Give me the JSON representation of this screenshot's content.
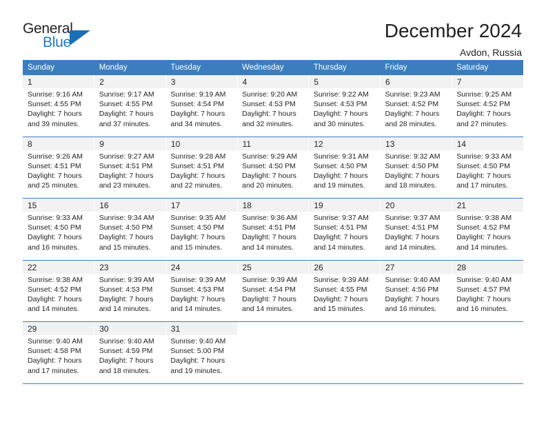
{
  "logo": {
    "word_top": "General",
    "word_bottom": "Blue",
    "triangle_icon": "triangle-icon",
    "accent_color": "#2079c4"
  },
  "header": {
    "title": "December 2024",
    "subtitle": "Avdon, Russia"
  },
  "theme": {
    "header_blue": "#3a7ebf",
    "daynum_bg": "#f2f2f2",
    "text": "#231f20"
  },
  "calendar": {
    "weekday_headers": [
      "Sunday",
      "Monday",
      "Tuesday",
      "Wednesday",
      "Thursday",
      "Friday",
      "Saturday"
    ],
    "weeks": [
      [
        {
          "day": "1",
          "sunrise": "Sunrise: 9:16 AM",
          "sunset": "Sunset: 4:55 PM",
          "daylight1": "Daylight: 7 hours",
          "daylight2": "and 39 minutes."
        },
        {
          "day": "2",
          "sunrise": "Sunrise: 9:17 AM",
          "sunset": "Sunset: 4:55 PM",
          "daylight1": "Daylight: 7 hours",
          "daylight2": "and 37 minutes."
        },
        {
          "day": "3",
          "sunrise": "Sunrise: 9:19 AM",
          "sunset": "Sunset: 4:54 PM",
          "daylight1": "Daylight: 7 hours",
          "daylight2": "and 34 minutes."
        },
        {
          "day": "4",
          "sunrise": "Sunrise: 9:20 AM",
          "sunset": "Sunset: 4:53 PM",
          "daylight1": "Daylight: 7 hours",
          "daylight2": "and 32 minutes."
        },
        {
          "day": "5",
          "sunrise": "Sunrise: 9:22 AM",
          "sunset": "Sunset: 4:53 PM",
          "daylight1": "Daylight: 7 hours",
          "daylight2": "and 30 minutes."
        },
        {
          "day": "6",
          "sunrise": "Sunrise: 9:23 AM",
          "sunset": "Sunset: 4:52 PM",
          "daylight1": "Daylight: 7 hours",
          "daylight2": "and 28 minutes."
        },
        {
          "day": "7",
          "sunrise": "Sunrise: 9:25 AM",
          "sunset": "Sunset: 4:52 PM",
          "daylight1": "Daylight: 7 hours",
          "daylight2": "and 27 minutes."
        }
      ],
      [
        {
          "day": "8",
          "sunrise": "Sunrise: 9:26 AM",
          "sunset": "Sunset: 4:51 PM",
          "daylight1": "Daylight: 7 hours",
          "daylight2": "and 25 minutes."
        },
        {
          "day": "9",
          "sunrise": "Sunrise: 9:27 AM",
          "sunset": "Sunset: 4:51 PM",
          "daylight1": "Daylight: 7 hours",
          "daylight2": "and 23 minutes."
        },
        {
          "day": "10",
          "sunrise": "Sunrise: 9:28 AM",
          "sunset": "Sunset: 4:51 PM",
          "daylight1": "Daylight: 7 hours",
          "daylight2": "and 22 minutes."
        },
        {
          "day": "11",
          "sunrise": "Sunrise: 9:29 AM",
          "sunset": "Sunset: 4:50 PM",
          "daylight1": "Daylight: 7 hours",
          "daylight2": "and 20 minutes."
        },
        {
          "day": "12",
          "sunrise": "Sunrise: 9:31 AM",
          "sunset": "Sunset: 4:50 PM",
          "daylight1": "Daylight: 7 hours",
          "daylight2": "and 19 minutes."
        },
        {
          "day": "13",
          "sunrise": "Sunrise: 9:32 AM",
          "sunset": "Sunset: 4:50 PM",
          "daylight1": "Daylight: 7 hours",
          "daylight2": "and 18 minutes."
        },
        {
          "day": "14",
          "sunrise": "Sunrise: 9:33 AM",
          "sunset": "Sunset: 4:50 PM",
          "daylight1": "Daylight: 7 hours",
          "daylight2": "and 17 minutes."
        }
      ],
      [
        {
          "day": "15",
          "sunrise": "Sunrise: 9:33 AM",
          "sunset": "Sunset: 4:50 PM",
          "daylight1": "Daylight: 7 hours",
          "daylight2": "and 16 minutes."
        },
        {
          "day": "16",
          "sunrise": "Sunrise: 9:34 AM",
          "sunset": "Sunset: 4:50 PM",
          "daylight1": "Daylight: 7 hours",
          "daylight2": "and 15 minutes."
        },
        {
          "day": "17",
          "sunrise": "Sunrise: 9:35 AM",
          "sunset": "Sunset: 4:50 PM",
          "daylight1": "Daylight: 7 hours",
          "daylight2": "and 15 minutes."
        },
        {
          "day": "18",
          "sunrise": "Sunrise: 9:36 AM",
          "sunset": "Sunset: 4:51 PM",
          "daylight1": "Daylight: 7 hours",
          "daylight2": "and 14 minutes."
        },
        {
          "day": "19",
          "sunrise": "Sunrise: 9:37 AM",
          "sunset": "Sunset: 4:51 PM",
          "daylight1": "Daylight: 7 hours",
          "daylight2": "and 14 minutes."
        },
        {
          "day": "20",
          "sunrise": "Sunrise: 9:37 AM",
          "sunset": "Sunset: 4:51 PM",
          "daylight1": "Daylight: 7 hours",
          "daylight2": "and 14 minutes."
        },
        {
          "day": "21",
          "sunrise": "Sunrise: 9:38 AM",
          "sunset": "Sunset: 4:52 PM",
          "daylight1": "Daylight: 7 hours",
          "daylight2": "and 14 minutes."
        }
      ],
      [
        {
          "day": "22",
          "sunrise": "Sunrise: 9:38 AM",
          "sunset": "Sunset: 4:52 PM",
          "daylight1": "Daylight: 7 hours",
          "daylight2": "and 14 minutes."
        },
        {
          "day": "23",
          "sunrise": "Sunrise: 9:39 AM",
          "sunset": "Sunset: 4:53 PM",
          "daylight1": "Daylight: 7 hours",
          "daylight2": "and 14 minutes."
        },
        {
          "day": "24",
          "sunrise": "Sunrise: 9:39 AM",
          "sunset": "Sunset: 4:53 PM",
          "daylight1": "Daylight: 7 hours",
          "daylight2": "and 14 minutes."
        },
        {
          "day": "25",
          "sunrise": "Sunrise: 9:39 AM",
          "sunset": "Sunset: 4:54 PM",
          "daylight1": "Daylight: 7 hours",
          "daylight2": "and 14 minutes."
        },
        {
          "day": "26",
          "sunrise": "Sunrise: 9:39 AM",
          "sunset": "Sunset: 4:55 PM",
          "daylight1": "Daylight: 7 hours",
          "daylight2": "and 15 minutes."
        },
        {
          "day": "27",
          "sunrise": "Sunrise: 9:40 AM",
          "sunset": "Sunset: 4:56 PM",
          "daylight1": "Daylight: 7 hours",
          "daylight2": "and 16 minutes."
        },
        {
          "day": "28",
          "sunrise": "Sunrise: 9:40 AM",
          "sunset": "Sunset: 4:57 PM",
          "daylight1": "Daylight: 7 hours",
          "daylight2": "and 16 minutes."
        }
      ],
      [
        {
          "day": "29",
          "sunrise": "Sunrise: 9:40 AM",
          "sunset": "Sunset: 4:58 PM",
          "daylight1": "Daylight: 7 hours",
          "daylight2": "and 17 minutes."
        },
        {
          "day": "30",
          "sunrise": "Sunrise: 9:40 AM",
          "sunset": "Sunset: 4:59 PM",
          "daylight1": "Daylight: 7 hours",
          "daylight2": "and 18 minutes."
        },
        {
          "day": "31",
          "sunrise": "Sunrise: 9:40 AM",
          "sunset": "Sunset: 5:00 PM",
          "daylight1": "Daylight: 7 hours",
          "daylight2": "and 19 minutes."
        },
        {
          "day": "",
          "sunrise": "",
          "sunset": "",
          "daylight1": "",
          "daylight2": "",
          "empty": true
        },
        {
          "day": "",
          "sunrise": "",
          "sunset": "",
          "daylight1": "",
          "daylight2": "",
          "empty": true
        },
        {
          "day": "",
          "sunrise": "",
          "sunset": "",
          "daylight1": "",
          "daylight2": "",
          "empty": true
        },
        {
          "day": "",
          "sunrise": "",
          "sunset": "",
          "daylight1": "",
          "daylight2": "",
          "empty": true
        }
      ]
    ]
  }
}
